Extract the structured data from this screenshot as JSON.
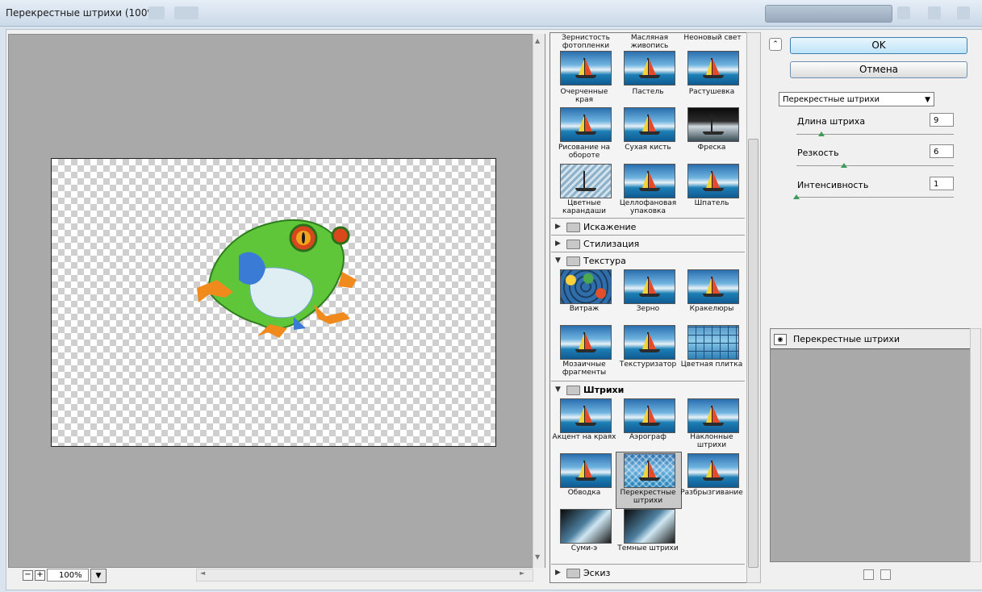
{
  "window": {
    "title": "Перекрестные штрихи (100%)"
  },
  "preview": {
    "zoom": "100%"
  },
  "gallery": {
    "top_labels": [
      "Зернистость фотопленки",
      "Масляная живопись",
      "Неоновый свет"
    ],
    "artistic_items": [
      "Очерченные края",
      "Пастель",
      "Растушевка",
      "Рисование на обороте",
      "Сухая кисть",
      "Фреска",
      "Цветные карандаши",
      "Целлофановая упаковка",
      "Шпатель"
    ],
    "categories": {
      "distort": "Искажение",
      "stylize": "Стилизация",
      "texture": "Текстура",
      "brush": "Штрихи",
      "sketch": "Эскиз"
    },
    "texture_items": [
      "Витраж",
      "Зерно",
      "Кракелюры",
      "Мозаичные фрагменты",
      "Текстуризатор",
      "Цветная плитка"
    ],
    "brush_items": [
      "Акцент на краях",
      "Аэрограф",
      "Наклонные штрихи",
      "Обводка",
      "Перекрестные штрихи",
      "Разбрызгивание",
      "Суми-э",
      "Темные штрихи"
    ],
    "selected": "Перекрестные штрихи"
  },
  "settings": {
    "ok": "OK",
    "cancel": "Отмена",
    "filter": "Перекрестные штрихи",
    "params": [
      {
        "label": "Длина штриха",
        "value": "9",
        "level_fraction": 0.16
      },
      {
        "label": "Резкость",
        "value": "6",
        "level_fraction": 0.3
      },
      {
        "label": "Интенсивность",
        "value": "1",
        "level_fraction": 0.0
      }
    ]
  },
  "layers": {
    "items": [
      "Перекрестные штрихи"
    ]
  }
}
